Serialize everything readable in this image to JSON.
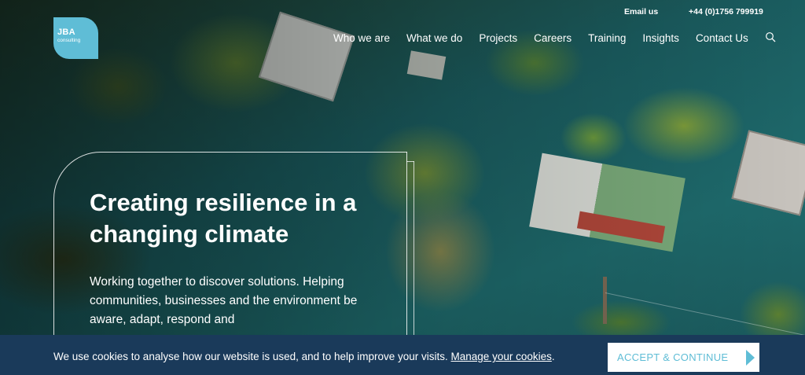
{
  "brand": {
    "logo_main": "JBA",
    "logo_sub": "consulting",
    "accent_color": "#5fbdd6",
    "cookie_bar_color": "#1a3a5a"
  },
  "topbar": {
    "email_label": "Email us",
    "phone_label": "+44 (0)1756 799919"
  },
  "nav": {
    "items": [
      {
        "label": "Who we are"
      },
      {
        "label": "What we do"
      },
      {
        "label": "Projects"
      },
      {
        "label": "Careers"
      },
      {
        "label": "Training"
      },
      {
        "label": "Insights"
      },
      {
        "label": "Contact Us"
      }
    ],
    "search_icon": "search-icon"
  },
  "hero": {
    "headline": "Creating resilience in a changing climate",
    "subtext": "Working together to discover solutions. Helping communities, businesses and the environment be aware, adapt, respond and"
  },
  "cookie": {
    "message": "We use cookies to analyse how our website is used, and to help improve your visits.",
    "link_text": "Manage your cookies",
    "period": ".",
    "accept_label": "ACCEPT & CONTINUE",
    "accept_icon": "chevron-right-icon"
  }
}
